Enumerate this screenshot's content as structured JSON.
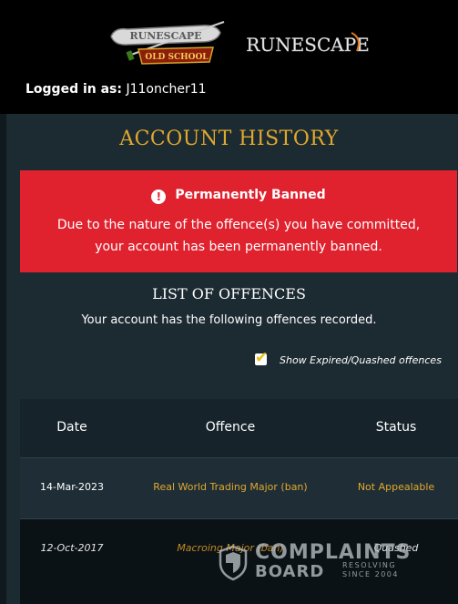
{
  "header": {
    "logo_osrs": {
      "line1": "RUNESCAPE",
      "line2": "OLD SCHOOL"
    },
    "logo_rs": "RUNESCAPE",
    "logged_in_label": "Logged in as:",
    "username": "J11oncher11"
  },
  "page_title": "ACCOUNT HISTORY",
  "ban_notice": {
    "icon": "alert-icon",
    "heading": "Permanently Banned",
    "line1": "Due to the nature of the offence(s) you have committed,",
    "line2": "your account has been permanently banned."
  },
  "offences": {
    "title": "LIST OF OFFENCES",
    "subtitle": "Your account has the following offences recorded.",
    "show_expired_label": "Show Expired/Quashed offences",
    "show_expired_checked": true,
    "columns": [
      "Date",
      "Offence",
      "Status"
    ],
    "rows": [
      {
        "date": "14-Mar-2023",
        "offence": "Real World Trading Major (ban)",
        "status": "Not Appealable"
      },
      {
        "date": "12-Oct-2017",
        "offence": "Macroing Major (ban)",
        "status": "Quashed"
      }
    ]
  },
  "watermark": {
    "line1": "COMPLAINTS",
    "line2": "BOARD",
    "line3": "RESOLVING",
    "line4": "SINCE 2004"
  },
  "colors": {
    "accent_gold": "#e0a82e",
    "ban_red": "#e0222e",
    "background": "#1c2a31"
  }
}
